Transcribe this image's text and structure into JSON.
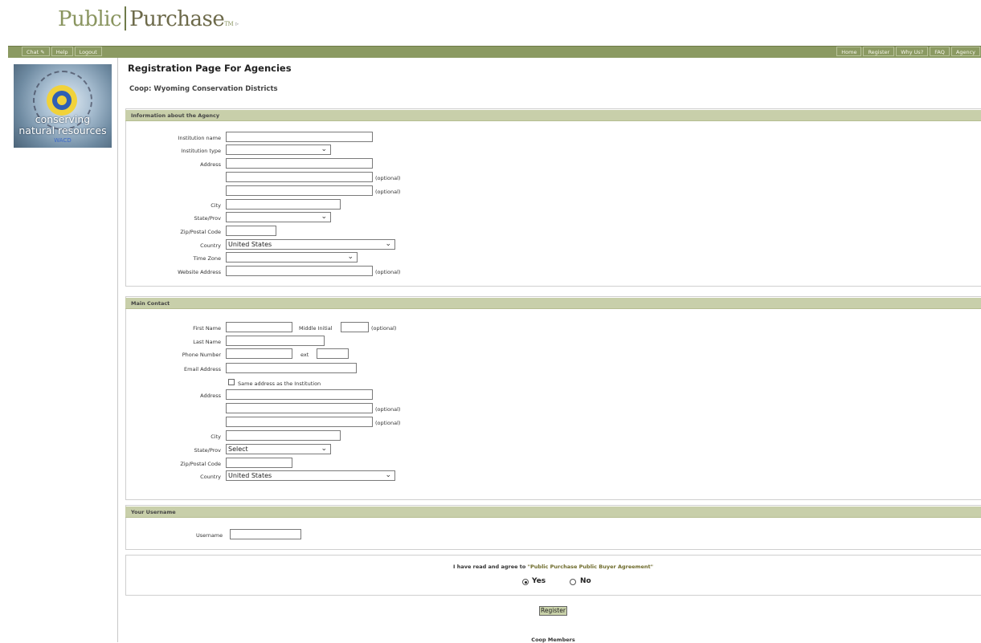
{
  "brand": {
    "part1": "Public",
    "part2": "Purchase",
    "tm": "TM"
  },
  "nav": {
    "left": [
      "Chat",
      "Help",
      "Logout"
    ],
    "right": [
      "Home",
      "Register",
      "Why Us?",
      "FAQ",
      "Agency"
    ]
  },
  "agency_logo": {
    "line1": "conserving",
    "line2": "natural resources",
    "line3": "WACD"
  },
  "page_title": "Registration Page For Agencies",
  "coop": "Coop: Wyoming Conservation Districts",
  "sections": {
    "agency": {
      "title": "Information about the Agency",
      "institution_name": "Institution name",
      "institution_type": "Institution type",
      "address": "Address",
      "optional": "(optional)",
      "city": "City",
      "state": "State/Prov",
      "zip": "Zip/Postal Code",
      "country": "Country",
      "country_value": "United States",
      "timezone": "Time Zone",
      "website": "Website Address"
    },
    "contact": {
      "title": "Main Contact",
      "first_name": "First Name",
      "middle_initial": "Middle Initial",
      "last_name": "Last Name",
      "phone": "Phone Number",
      "ext": "ext",
      "email": "Email Address",
      "same_address": "Same address as the Institution",
      "address": "Address",
      "optional": "(optional)",
      "city": "City",
      "state": "State/Prov",
      "state_value": "Select",
      "zip": "Zip/Postal Code",
      "country": "Country",
      "country_value": "United States"
    },
    "username": {
      "title": "Your Username",
      "label": "Username"
    },
    "agreement": {
      "text": "I have read and agree to",
      "link": "\"Public Purchase Public Buyer Agreement\"",
      "yes": "Yes",
      "no": "No",
      "selected": "Yes"
    }
  },
  "register_button": "Register",
  "footer": "Coop Members"
}
